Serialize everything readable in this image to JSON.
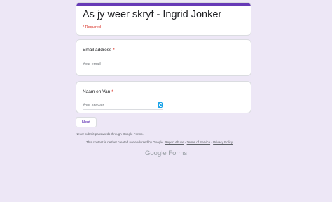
{
  "form": {
    "title": "As jy weer skryf - Ingrid Jonker",
    "required_note": "* Required",
    "accent_color": "#673ab7",
    "background_color": "#ede7f6"
  },
  "questions": [
    {
      "label": "Email address",
      "required_mark": "*",
      "placeholder": "Your email"
    },
    {
      "label": "Naam en Van",
      "required_mark": "*",
      "placeholder": "Your answer"
    }
  ],
  "actions": {
    "next_label": "Next"
  },
  "footer": {
    "password_note": "Never submit passwords through Google Forms.",
    "disclaimer_prefix": "This content is neither created nor endorsed by Google.",
    "report_abuse": "Report Abuse",
    "sep1": "-",
    "terms": "Terms of Service",
    "sep2": "-",
    "privacy": "Privacy Policy",
    "logo_text": "Google Forms"
  },
  "icons": {
    "input_extension": "extension-icon"
  }
}
